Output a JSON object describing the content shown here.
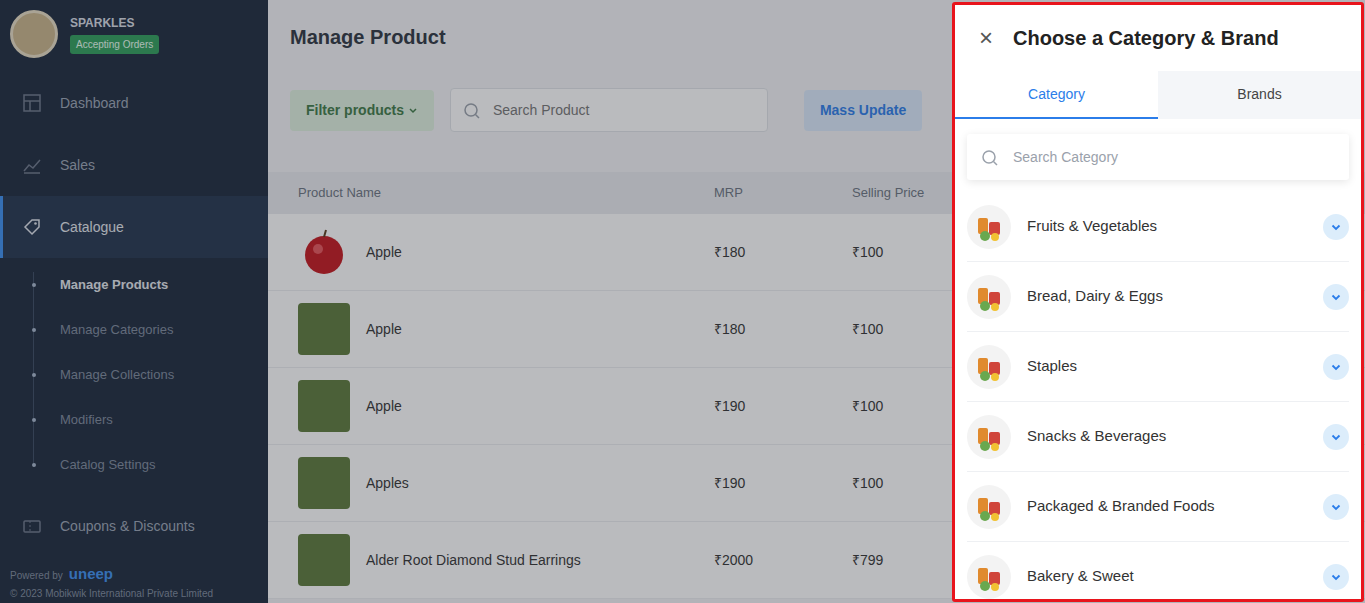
{
  "sidebar": {
    "store_name": "SPARKLES",
    "status": "Accepting Orders",
    "items": [
      {
        "label": "Dashboard",
        "selected": false
      },
      {
        "label": "Sales",
        "selected": false
      },
      {
        "label": "Catalogue",
        "selected": true
      }
    ],
    "sub_items": [
      {
        "label": "Manage Products",
        "selected": true
      },
      {
        "label": "Manage Categories",
        "selected": false
      },
      {
        "label": "Manage Collections",
        "selected": false
      },
      {
        "label": "Modifiers",
        "selected": false
      },
      {
        "label": "Catalog Settings",
        "selected": false
      }
    ],
    "more_items": [
      {
        "label": "Coupons & Discounts",
        "selected": false
      }
    ],
    "footer": {
      "powered_by": "Powered by",
      "brand": "uneep",
      "copyright": "© 2023 Mobikwik International Private Limited"
    }
  },
  "main": {
    "title": "Manage Product",
    "filter_button": "Filter products",
    "search": {
      "placeholder": "Search Product"
    },
    "mass_update": "Mass Update",
    "table": {
      "columns": [
        "Product Name",
        "MRP",
        "Selling Price"
      ],
      "rows": [
        [
          "Apple",
          "₹180",
          "₹100"
        ],
        [
          "Apple",
          "₹180",
          "₹100"
        ],
        [
          "Apple",
          "₹190",
          "₹100"
        ],
        [
          "Apples",
          "₹190",
          "₹100"
        ],
        [
          "Alder Root Diamond Stud Earrings",
          "₹2000",
          "₹799"
        ]
      ]
    }
  },
  "drawer": {
    "close": "×",
    "title": "Choose a Category & Brand",
    "tabs": [
      {
        "label": "Category",
        "selected": true
      },
      {
        "label": "Brands",
        "selected": false
      }
    ],
    "search": {
      "placeholder": "Search Category"
    },
    "categories": [
      {
        "label": "Fruits & Vegetables",
        "expanded": false
      },
      {
        "label": "Bread, Dairy & Eggs",
        "expanded": false
      },
      {
        "label": "Staples",
        "expanded": false
      },
      {
        "label": "Snacks & Beverages",
        "expanded": false
      },
      {
        "label": "Packaged & Branded Foods",
        "expanded": false
      },
      {
        "label": "Bakery & Sweet",
        "expanded": false
      }
    ]
  }
}
